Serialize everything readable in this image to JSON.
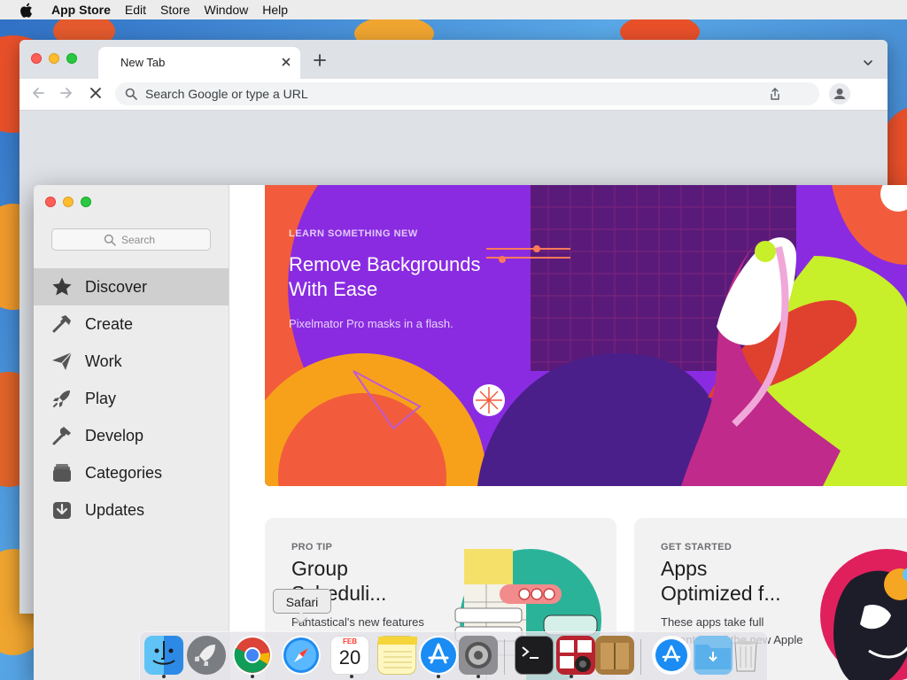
{
  "menubar": {
    "app_name": "App Store",
    "items": [
      "Edit",
      "Store",
      "Window",
      "Help"
    ]
  },
  "chrome": {
    "tab_title": "New Tab",
    "omnibox_placeholder": "Search Google or type a URL"
  },
  "appstore": {
    "search_placeholder": "Search",
    "nav": [
      {
        "label": "Discover",
        "icon": "star-icon",
        "active": true
      },
      {
        "label": "Create",
        "icon": "hammer-brush-icon",
        "active": false
      },
      {
        "label": "Work",
        "icon": "paper-plane-icon",
        "active": false
      },
      {
        "label": "Play",
        "icon": "rocket-icon",
        "active": false
      },
      {
        "label": "Develop",
        "icon": "hammer-icon",
        "active": false
      },
      {
        "label": "Categories",
        "icon": "stack-icon",
        "active": false
      },
      {
        "label": "Updates",
        "icon": "download-icon",
        "active": false
      }
    ],
    "hero": {
      "eyebrow": "LEARN SOMETHING NEW",
      "title": "Remove Backgrounds With Ease",
      "subtitle": "Pixelmator Pro masks in a flash."
    },
    "cards": [
      {
        "eyebrow": "PRO TIP",
        "title": "Group\nScheduli...",
        "desc": "Fantastical's new features"
      },
      {
        "eyebrow": "GET STARTED",
        "title": "Apps\nOptimized f...",
        "desc": "These apps take full advantage of the new Apple"
      }
    ]
  },
  "tooltip": {
    "text": "Safari"
  },
  "dock": {
    "apps": [
      {
        "name": "Finder",
        "icon": "finder-icon",
        "running": true
      },
      {
        "name": "Launchpad",
        "icon": "launchpad-icon",
        "running": false
      },
      {
        "name": "Google Chrome",
        "icon": "chrome-icon",
        "running": true
      },
      {
        "name": "Safari",
        "icon": "safari-icon",
        "running": false
      },
      {
        "name": "Calendar",
        "icon": "calendar-icon",
        "running": true,
        "month": "FEB",
        "day": "20"
      },
      {
        "name": "Notes",
        "icon": "notes-icon",
        "running": false
      },
      {
        "name": "App Store",
        "icon": "app-store-icon",
        "running": true
      },
      {
        "name": "System Preferences",
        "icon": "system-preferences-icon",
        "running": true
      },
      {
        "name": "Terminal",
        "icon": "terminal-icon",
        "running": false
      },
      {
        "name": "Photo Booth",
        "icon": "photo-booth-icon",
        "running": true
      },
      {
        "name": "Archive Utility",
        "icon": "archive-icon",
        "running": false
      },
      {
        "name": "Downloads",
        "icon": "downloads-stack-icon",
        "running": false
      },
      {
        "name": "Downloads Folder",
        "icon": "folder-icon",
        "running": false
      },
      {
        "name": "Trash",
        "icon": "trash-icon",
        "running": false
      }
    ]
  }
}
